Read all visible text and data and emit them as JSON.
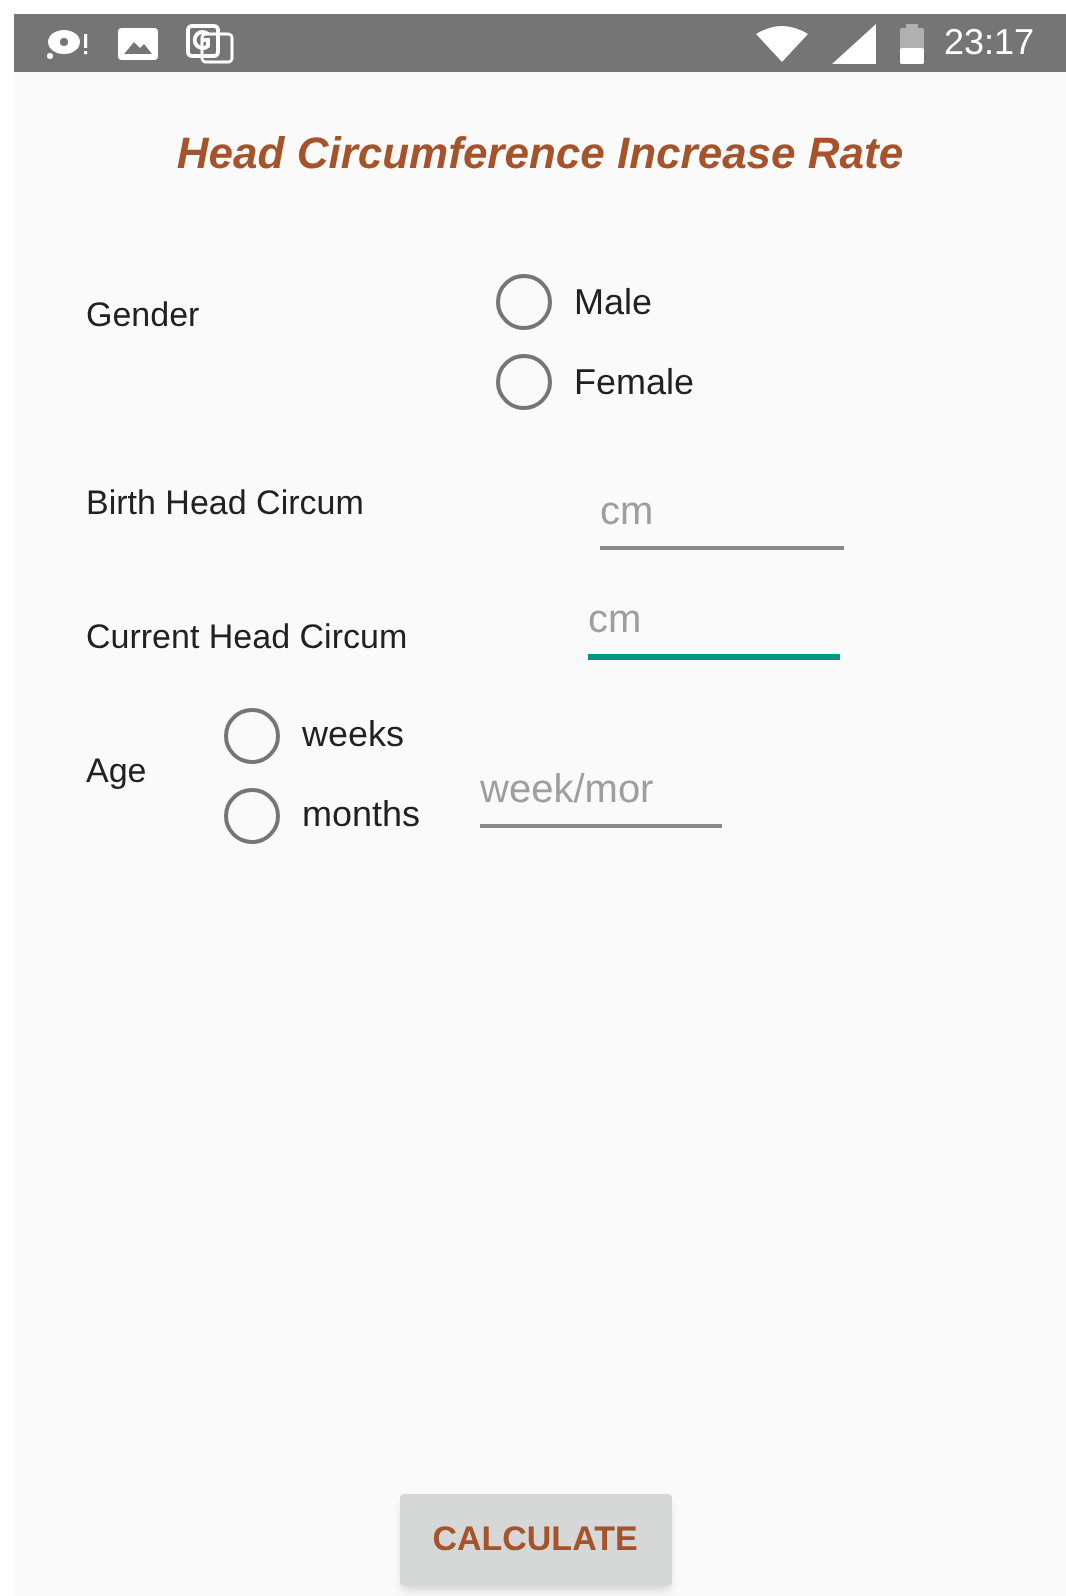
{
  "status_bar": {
    "time": "23:17"
  },
  "title": "Head Circumference Increase Rate",
  "gender": {
    "label": "Gender",
    "options": [
      {
        "label": "Male",
        "selected": false
      },
      {
        "label": "Female",
        "selected": false
      }
    ]
  },
  "birth": {
    "label": "Birth Head Circum",
    "placeholder": "cm",
    "focused": false
  },
  "current": {
    "label": "Current Head Circum",
    "placeholder": "cm",
    "focused": true
  },
  "age": {
    "label": "Age",
    "options": [
      {
        "label": "weeks",
        "selected": false
      },
      {
        "label": "months",
        "selected": false
      }
    ],
    "placeholder": "week/mor",
    "focused": false
  },
  "button": "CALCULATE"
}
